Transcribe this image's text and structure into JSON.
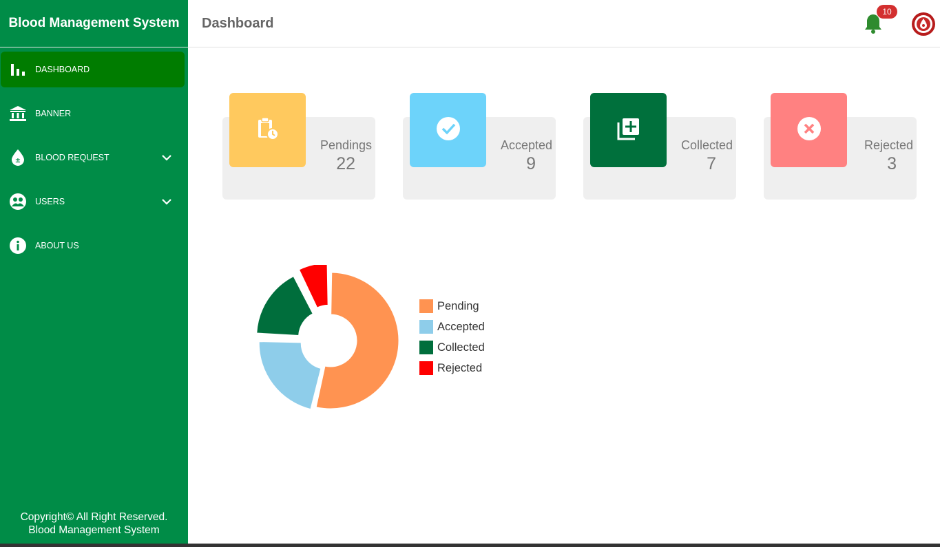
{
  "brand": "Blood Management System",
  "header": {
    "title": "Dashboard",
    "notification_count": "10"
  },
  "sidebar": {
    "items": [
      {
        "label": "DASHBOARD",
        "icon": "bar-chart-icon",
        "active": true
      },
      {
        "label": "BANNER",
        "icon": "bank-icon"
      },
      {
        "label": "BLOOD REQUEST",
        "icon": "blood-drop-icon",
        "expandable": true
      },
      {
        "label": "USERS",
        "icon": "users-icon",
        "expandable": true
      },
      {
        "label": "ABOUT US",
        "icon": "info-icon"
      }
    ],
    "footer_line1": "Copyright© All Right Reserved.",
    "footer_line2": "Blood Management System"
  },
  "cards": [
    {
      "label": "Pendings",
      "value": "22",
      "color": "#ffc95e",
      "icon": "clipboard-clock-icon"
    },
    {
      "label": "Accepted",
      "value": "9",
      "color": "#6dd3fa",
      "icon": "check-circle-icon"
    },
    {
      "label": "Collected",
      "value": "7",
      "color": "#00703c",
      "icon": "library-add-icon"
    },
    {
      "label": "Rejected",
      "value": "3",
      "color": "#ff8181",
      "icon": "cancel-circle-icon"
    }
  ],
  "chart_data": {
    "type": "pie",
    "variant": "donut",
    "legend_position": "right",
    "categories": [
      "Pending",
      "Accepted",
      "Collected",
      "Rejected"
    ],
    "values": [
      22,
      9,
      7,
      3
    ],
    "colors": [
      "#ff9351",
      "#8ecdea",
      "#006e3c",
      "#ff0000"
    ]
  }
}
